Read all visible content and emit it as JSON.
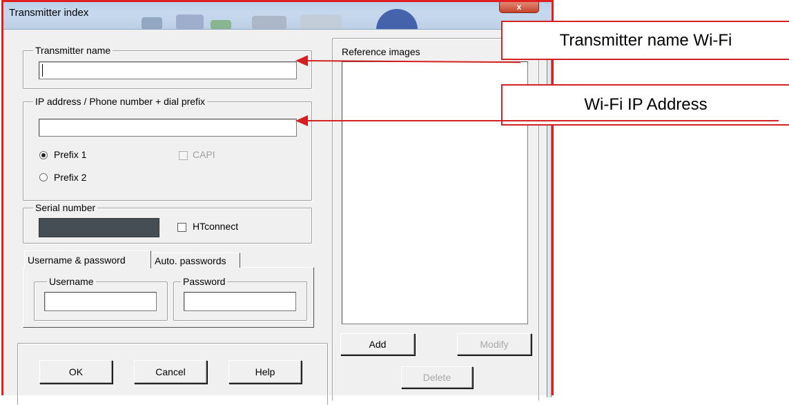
{
  "window": {
    "title": "Transmitter index",
    "close_glyph": "x"
  },
  "transmitter_name": {
    "legend": "Transmitter name",
    "value": ""
  },
  "ip_group": {
    "legend": "IP address / Phone number + dial prefix",
    "value": "",
    "prefix1_label": "Prefix 1",
    "prefix2_label": "Prefix 2",
    "prefix_selected": "Prefix 1",
    "capi_label": "CAPI",
    "capi_checked": false,
    "capi_enabled": false
  },
  "serial_group": {
    "legend": "Serial number",
    "htconnect_label": "HTconnect",
    "htconnect_checked": false
  },
  "tabs": {
    "items": [
      {
        "label": "Username & password",
        "active": true
      },
      {
        "label": "Auto. passwords",
        "active": false
      }
    ]
  },
  "credentials": {
    "username_legend": "Username",
    "username_value": "",
    "password_legend": "Password",
    "password_value": ""
  },
  "reference_images": {
    "legend": "Reference images",
    "add_label": "Add",
    "modify_label": "Modify",
    "delete_label": "Delete"
  },
  "footer": {
    "ok_label": "OK",
    "cancel_label": "Cancel",
    "help_label": "Help"
  },
  "annotations": {
    "callout1": "Transmitter name Wi-Fi",
    "callout2": "Wi-Fi IP Address",
    "accent_color": "#d42020"
  }
}
